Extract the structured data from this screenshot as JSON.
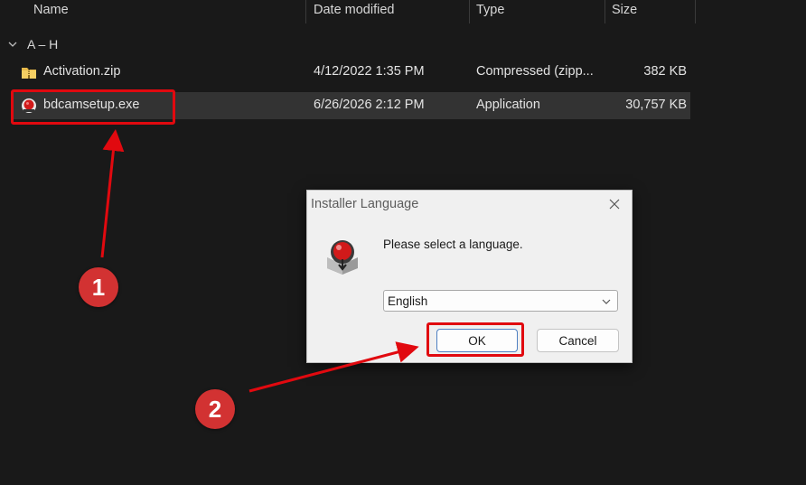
{
  "columns": {
    "name": "Name",
    "date": "Date modified",
    "type": "Type",
    "size": "Size"
  },
  "group": {
    "label": "A – H"
  },
  "files": [
    {
      "name": "Activation.zip",
      "date": "4/12/2022 1:35 PM",
      "type": "Compressed (zipp...",
      "size": "382 KB",
      "icon": "zip-folder-icon"
    },
    {
      "name": "bdcamsetup.exe",
      "date": "6/26/2026 2:12 PM",
      "type": "Application",
      "size": "30,757 KB",
      "icon": "bandicam-icon",
      "selected": true
    }
  ],
  "dialog": {
    "title": "Installer Language",
    "prompt": "Please select a language.",
    "selected_language": "English",
    "ok_label": "OK",
    "cancel_label": "Cancel"
  },
  "annotations": {
    "step1": "1",
    "step2": "2"
  },
  "colors": {
    "highlight": "#e1090f",
    "badge": "#d23232",
    "background": "#191919",
    "selected_row": "#333333"
  }
}
